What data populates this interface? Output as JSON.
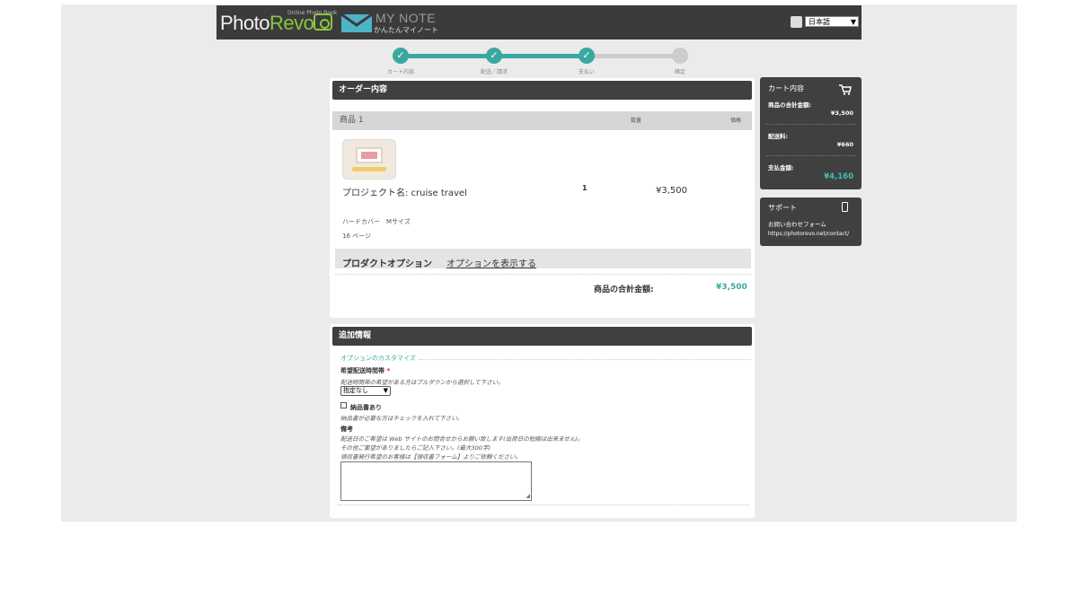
{
  "header": {
    "logo_photo": "Photo",
    "logo_revo": "Revo",
    "logo_sub": "Online Photo Book",
    "mynote_title": "MY NOTE",
    "mynote_sub": "かんたんマイノート",
    "language": "日本語"
  },
  "steps": [
    {
      "label": "カート内容",
      "done": true
    },
    {
      "label": "配送／請求",
      "done": true
    },
    {
      "label": "支払い",
      "done": true
    },
    {
      "label": "確定",
      "done": false
    }
  ],
  "order": {
    "title": "オーダー内容",
    "col_item": "商品 1",
    "col_qty": "数量",
    "col_price": "価格",
    "project_name": "プロジェクト名: cruise travel",
    "quantity": "1",
    "price": "¥3,500",
    "cover": "ハードカバー　Mサイズ",
    "pages": "16 ページ",
    "options_label": "プロダクトオプション",
    "options_link": "オプションを表示する",
    "subtotal_label": "商品の合計金額:",
    "subtotal_value": "¥3,500"
  },
  "extra": {
    "title": "追加情報",
    "section": "オプションのカスタマイズ",
    "delivery_label": "希望配送時間帯",
    "required_mark": "*",
    "delivery_help": "配送時間帯の希望がある方はプルダウンから選択して下さい。",
    "delivery_value": "指定なし",
    "receipt_label": "納品書あり",
    "receipt_help": "納品書が必要な方はチェックを入れて下さい。",
    "notes_label": "備考",
    "notes_help_1": "配送日のご希望は Web サイトのお問合せからお願い致します(出荷日の短縮は出来ません)。",
    "notes_help_2": "その他ご要望がありましたらご記入下さい。(最大300字)",
    "notes_help_3": "領収書発行希望のお客様は【領収書フォーム】よりご依頼ください。"
  },
  "cart": {
    "title": "カート内容",
    "items_label": "商品の合計金額:",
    "items_value": "¥3,500",
    "shipping_label": "配送料:",
    "shipping_value": "¥660",
    "total_label": "支払金額:",
    "total_value": "¥4,160"
  },
  "support": {
    "title": "サポート",
    "contact_label": "お問い合わせフォーム",
    "contact_url": "https://photorevo.net/contact/"
  },
  "colors": {
    "accent": "#3aa8a0",
    "dark": "#404040",
    "brand_green": "#8cc63f"
  }
}
